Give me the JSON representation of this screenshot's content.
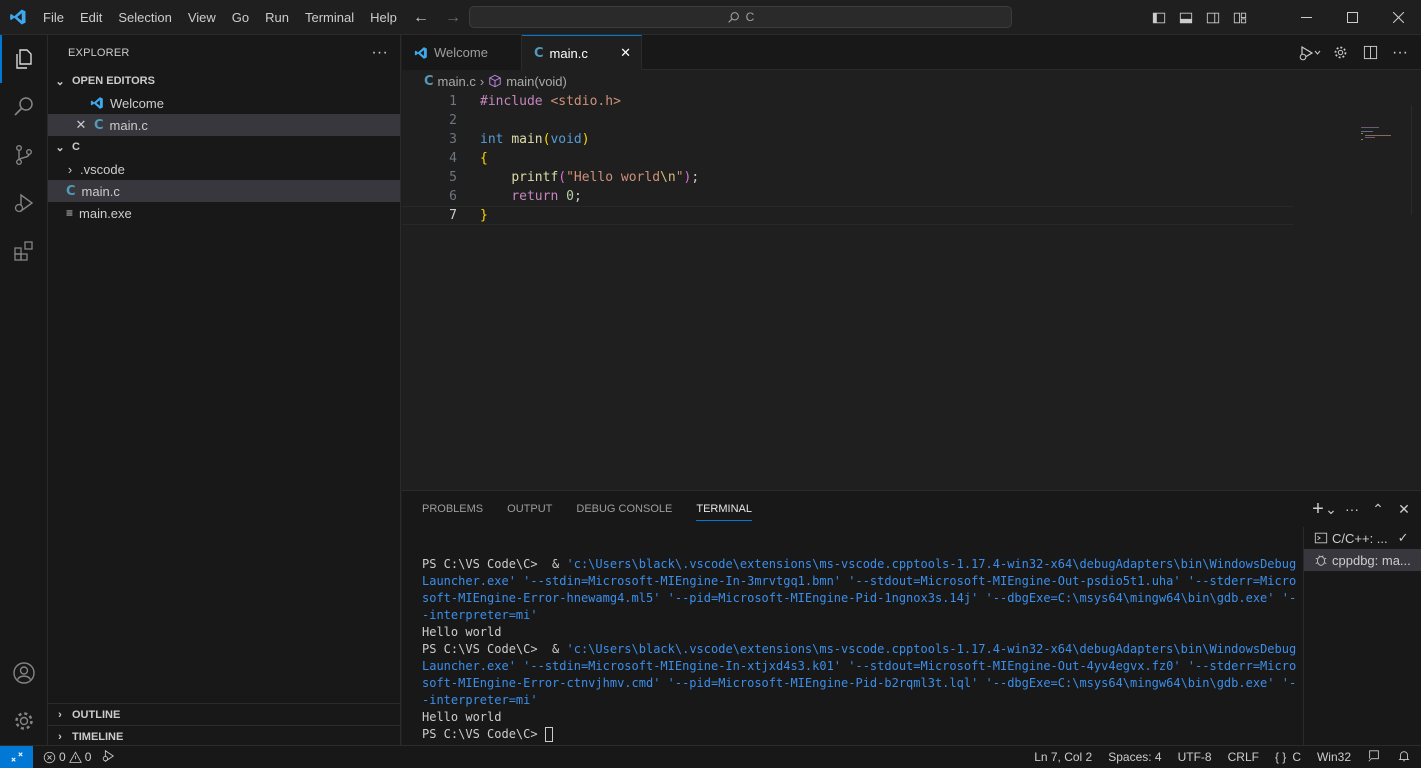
{
  "titlebar": {
    "menu": [
      "File",
      "Edit",
      "Selection",
      "View",
      "Go",
      "Run",
      "Terminal",
      "Help"
    ],
    "search": "C"
  },
  "sidebar": {
    "title": "EXPLORER",
    "open_editors_label": "OPEN EDITORS",
    "open_editors": [
      {
        "name": "Welcome",
        "icon": "vscode-icon"
      },
      {
        "name": "main.c",
        "icon": "c-file-icon"
      }
    ],
    "folder_label": "C",
    "files": [
      {
        "name": ".vscode",
        "type": "folder"
      },
      {
        "name": "main.c",
        "type": "c-file"
      },
      {
        "name": "main.exe",
        "type": "binary"
      }
    ],
    "outline_label": "OUTLINE",
    "timeline_label": "TIMELINE"
  },
  "editor": {
    "tabs": [
      {
        "label": "Welcome"
      },
      {
        "label": "main.c"
      }
    ],
    "breadcrumb": {
      "file": "main.c",
      "symbol": "main(void)"
    },
    "line_numbers": [
      "1",
      "2",
      "3",
      "4",
      "5",
      "6",
      "7"
    ]
  },
  "panel": {
    "tabs": [
      "PROBLEMS",
      "OUTPUT",
      "DEBUG CONSOLE",
      "TERMINAL"
    ],
    "terminal_prompt": "PS C:\\VS Code\\C>",
    "terminal_cmd1_path": "'c:\\Users\\black\\.vscode\\extensions\\ms-vscode.cpptools-1.17.4-win32-x64\\debugAdapters\\bin\\WindowsDebugLauncher.exe'",
    "terminal_cmd1_args": " '--stdin=Microsoft-MIEngine-In-3mrvtgq1.bmn' '--stdout=Microsoft-MIEngine-Out-psdio5t1.uha' '--stderr=Microsoft-MIEngine-Error-hnewamg4.ml5' '--pid=Microsoft-MIEngine-Pid-1ngnox3s.14j' '--dbgExe=C:\\msys64\\mingw64\\bin\\gdb.exe' '--interpreter=mi'",
    "terminal_output1": "Hello world",
    "terminal_cmd2_path": "'c:\\Users\\black\\.vscode\\extensions\\ms-vscode.cpptools-1.17.4-win32-x64\\debugAdapters\\bin\\WindowsDebugLauncher.exe'",
    "terminal_cmd2_args": " '--stdin=Microsoft-MIEngine-In-xtjxd4s3.k01' '--stdout=Microsoft-MIEngine-Out-4yv4egvx.fz0' '--stderr=Microsoft-MIEngine-Error-ctnvjhmv.cmd' '--pid=Microsoft-MIEngine-Pid-b2rqml3t.lql' '--dbgExe=C:\\msys64\\mingw64\\bin\\gdb.exe' '--interpreter=mi'",
    "terminal_output2": "Hello world",
    "terminals": [
      "C/C++: ...",
      "cppdbg: ma..."
    ]
  },
  "statusbar": {
    "errors": "0",
    "warnings": "0",
    "position": "Ln 7, Col 2",
    "spaces": "Spaces: 4",
    "encoding": "UTF-8",
    "eol": "CRLF",
    "language": "C",
    "platform": "Win32"
  },
  "colors": {
    "accent": "#0078d4",
    "background": "#1f1f1f",
    "sidebar": "#181818"
  }
}
